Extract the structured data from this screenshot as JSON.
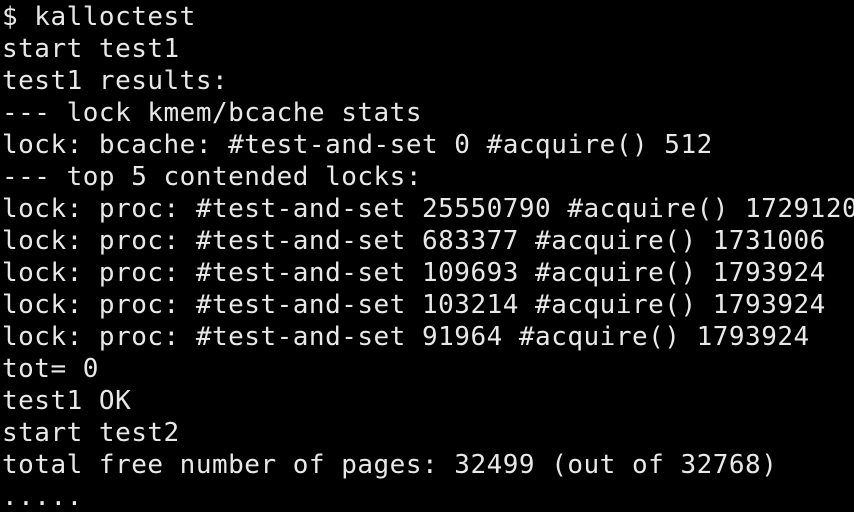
{
  "terminal": {
    "lines": [
      "$ kalloctest",
      "start test1",
      "test1 results:",
      "--- lock kmem/bcache stats",
      "lock: bcache: #test-and-set 0 #acquire() 512",
      "--- top 5 contended locks:",
      "lock: proc: #test-and-set 25550790 #acquire() 1729120",
      "lock: proc: #test-and-set 683377 #acquire() 1731006",
      "lock: proc: #test-and-set 109693 #acquire() 1793924",
      "lock: proc: #test-and-set 103214 #acquire() 1793924",
      "lock: proc: #test-and-set 91964 #acquire() 1793924",
      "tot= 0",
      "test1 OK",
      "start test2",
      "total free number of pages: 32499 (out of 32768)",
      "....."
    ]
  },
  "colors": {
    "background": "#000000",
    "foreground": "#e8e8e8"
  }
}
